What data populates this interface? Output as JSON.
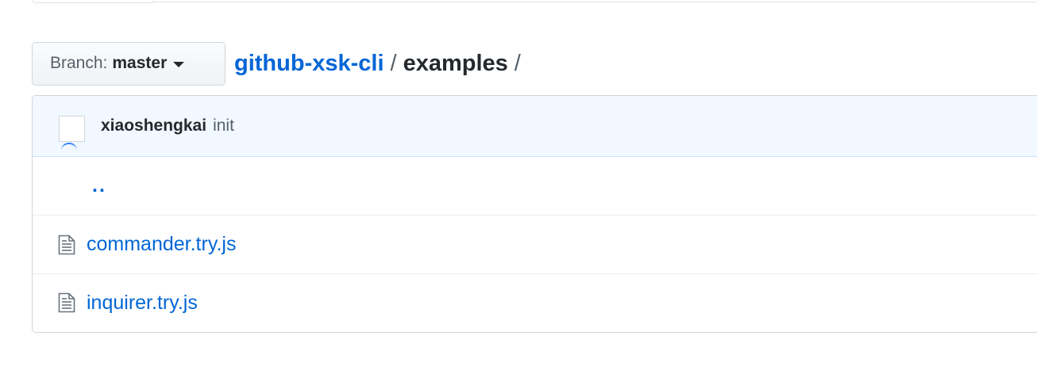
{
  "branch": {
    "prefix": "Branch:",
    "name": "master"
  },
  "breadcrumb": {
    "repo": "github-xsk-cli",
    "separator": "/",
    "current": "examples",
    "trailing": "/"
  },
  "commit": {
    "author": "xiaoshengkai",
    "message": "init"
  },
  "files": [
    {
      "type": "parent",
      "name": ".."
    },
    {
      "type": "file",
      "name": "commander.try.js",
      "icon": "file-text-icon"
    },
    {
      "type": "file",
      "name": "inquirer.try.js",
      "icon": "file-text-icon"
    }
  ],
  "colors": {
    "link": "#0366d6",
    "commit_bar_bg": "#f1f8ff",
    "border": "#d1d5da"
  }
}
